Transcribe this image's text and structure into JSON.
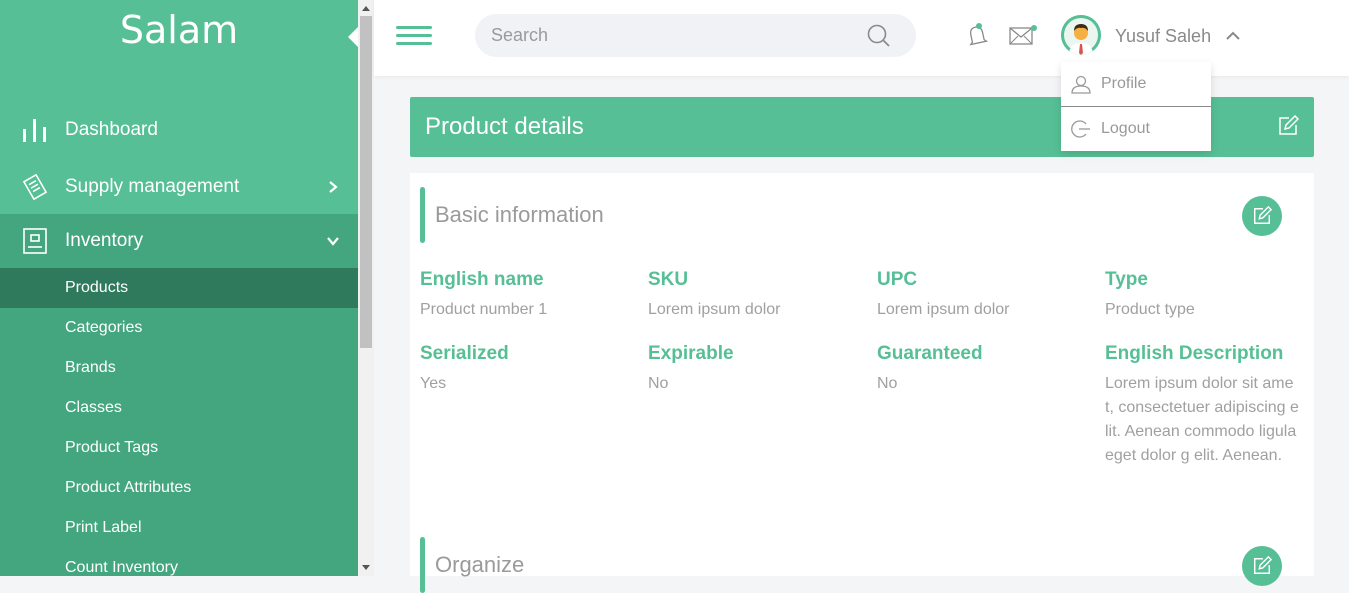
{
  "brand": "Salam",
  "sidebar": {
    "items": [
      {
        "label": "Dashboard",
        "icon": "bar-chart-icon"
      },
      {
        "label": "Supply management",
        "icon": "document-icon"
      },
      {
        "label": "Inventory",
        "icon": "inventory-icon"
      }
    ],
    "submenu": [
      "Products",
      "Categories",
      "Brands",
      "Classes",
      "Product Tags",
      "Product Attributes",
      "Print Label",
      "Count Inventory"
    ],
    "selected": "Products"
  },
  "topbar": {
    "search_placeholder": "Search",
    "username": "Yusuf Saleh"
  },
  "dropdown": {
    "profile": "Profile",
    "logout": "Logout"
  },
  "page": {
    "title": "Product details"
  },
  "sections": {
    "basic": {
      "title": "Basic information",
      "fields": [
        {
          "label": "English name",
          "value": "Product number 1"
        },
        {
          "label": "SKU",
          "value": "Lorem ipsum dolor"
        },
        {
          "label": "UPC",
          "value": "Lorem ipsum dolor"
        },
        {
          "label": "Type",
          "value": "Product type"
        },
        {
          "label": "Serialized",
          "value": "Yes"
        },
        {
          "label": "Expirable",
          "value": "No"
        },
        {
          "label": "Guaranteed",
          "value": "No"
        },
        {
          "label": "English Description",
          "value": "Lorem ipsum dolor sit amet, consectetuer adipiscing elit. Aenean commodo ligula eget dolor g elit. Aenean."
        }
      ]
    },
    "organize": {
      "title": "Organize"
    }
  },
  "colors": {
    "accent": "#56bf95",
    "accent_dark": "#44a67f",
    "selected": "#2f7a5c"
  }
}
